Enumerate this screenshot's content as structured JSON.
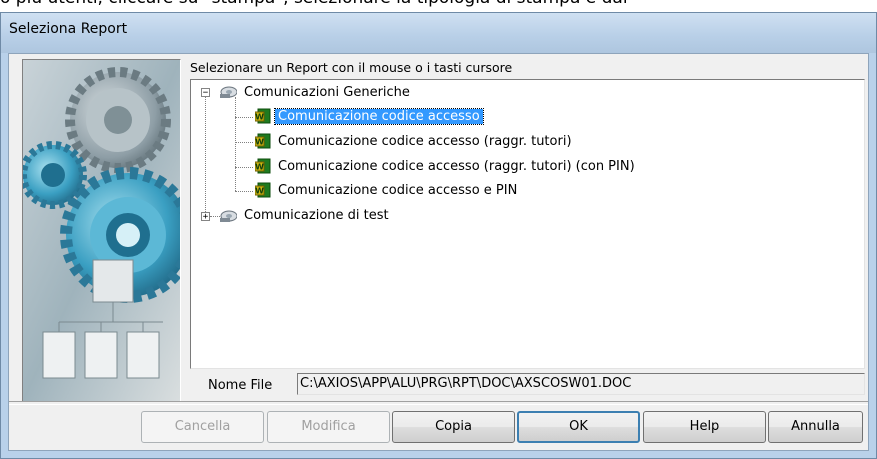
{
  "background_text": "o più utenti, cliccare su \"stampa\", selezionare la tipologia di stampa e dal",
  "window": {
    "title": "Seleziona Report"
  },
  "dialog": {
    "prompt": "Selezionare un Report con il mouse o i tasti cursore",
    "tree": {
      "root_expanded": {
        "label": "Comunicazioni Generiche",
        "icon": "cd-drive-icon",
        "expander": "−",
        "children": [
          {
            "label": "Comunicazione codice accesso",
            "icon": "word-doc-icon",
            "selected": true
          },
          {
            "label": "Comunicazione codice accesso (raggr. tutori)",
            "icon": "word-doc-icon"
          },
          {
            "label": "Comunicazione codice accesso (raggr. tutori) (con PIN)",
            "icon": "word-doc-icon"
          },
          {
            "label": "Comunicazione codice accesso e PIN",
            "icon": "word-doc-icon"
          }
        ]
      },
      "root_collapsed": {
        "label": "Comunicazione di test",
        "icon": "cd-drive-icon",
        "expander": "+"
      }
    },
    "file_name_label": "Nome File",
    "file_name_value": "C:\\AXIOS\\APP\\ALU\\PRG\\RPT\\DOC\\AXSCOSW01.DOC"
  },
  "buttons": {
    "cancella": "Cancella",
    "modifica": "Modifica",
    "copia": "Copia",
    "ok": "OK",
    "help": "Help",
    "annulla": "Annulla"
  },
  "colors": {
    "selection": "#3399ff",
    "window_frame": "#b9d1ea",
    "dialog_bg": "#f0f0f0",
    "word_icon": "#2b8a2b"
  }
}
